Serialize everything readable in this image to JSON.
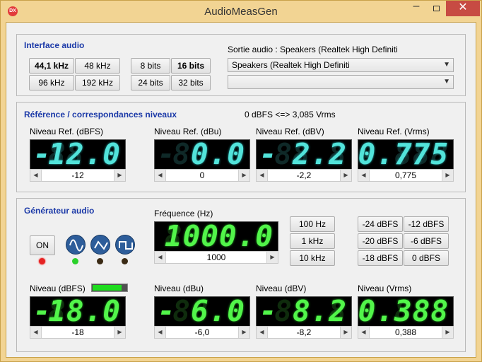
{
  "window": {
    "title": "AudioMeasGen",
    "icon_text": "DX"
  },
  "interface": {
    "title": "Interface audio",
    "sample_rates": [
      "44,1 kHz",
      "48 kHz",
      "96 kHz",
      "192 kHz"
    ],
    "selected_rate": "44,1 kHz",
    "bit_depths": [
      "8 bits",
      "16 bits",
      "24 bits",
      "32 bits"
    ],
    "selected_bits": "16 bits",
    "output_label": "Sortie audio : Speakers (Realtek High Definiti",
    "output_device": "Speakers (Realtek High Definiti",
    "output_device2": ""
  },
  "reference": {
    "title": "Référence / correspondances niveaux",
    "summary": "0 dBFS <=> 3,085 Vrms",
    "meters": [
      {
        "label": "Niveau Ref. (dBFS)",
        "display": "12.0",
        "ghost": "88.8",
        "negative": true,
        "spin": "-12"
      },
      {
        "label": "Niveau Ref. (dBu)",
        "display": "0.0",
        "ghost": "88.8",
        "negative": false,
        "spin": "0"
      },
      {
        "label": "Niveau Ref. (dBV)",
        "display": "2.2",
        "ghost": "88.8",
        "negative": true,
        "spin": "-2,2"
      },
      {
        "label": "Niveau Ref. (Vrms)",
        "display": "0.775",
        "ghost": "8.888",
        "negative": false,
        "spin": "0,775"
      }
    ]
  },
  "generator": {
    "title": "Générateur audio",
    "on_label": "ON",
    "waveforms": [
      "sine",
      "triangle",
      "square"
    ],
    "active_waveform": "sine",
    "frequency": {
      "label": "Fréquence (Hz)",
      "display": "1000.0",
      "ghost": "8888.8",
      "spin": "1000"
    },
    "freq_buttons": [
      "100 Hz",
      "1 kHz",
      "10 kHz"
    ],
    "level_buttons": [
      "-24 dBFS",
      "-12 dBFS",
      "-20 dBFS",
      "-6 dBFS",
      "-18 dBFS",
      "0 dBFS"
    ],
    "level_bar": 0.85,
    "meters": [
      {
        "label": "Niveau (dBFS)",
        "display": "18.0",
        "ghost": "88.8",
        "negative": true,
        "spin": "-18"
      },
      {
        "label": "Niveau (dBu)",
        "display": "6.0",
        "ghost": "88.8",
        "negative": true,
        "spin": "-6,0"
      },
      {
        "label": "Niveau (dBV)",
        "display": "8.2",
        "ghost": "88.8",
        "negative": true,
        "spin": "-8,2"
      },
      {
        "label": "Niveau (Vrms)",
        "display": "0.388",
        "ghost": "8.888",
        "negative": false,
        "spin": "0,388"
      }
    ]
  },
  "colors": {
    "accent": "#1c3aa8",
    "cyan_digit": "#52e3da",
    "green_digit": "#52f54a",
    "titlebar": "#f2d493",
    "close": "#c74b43"
  }
}
